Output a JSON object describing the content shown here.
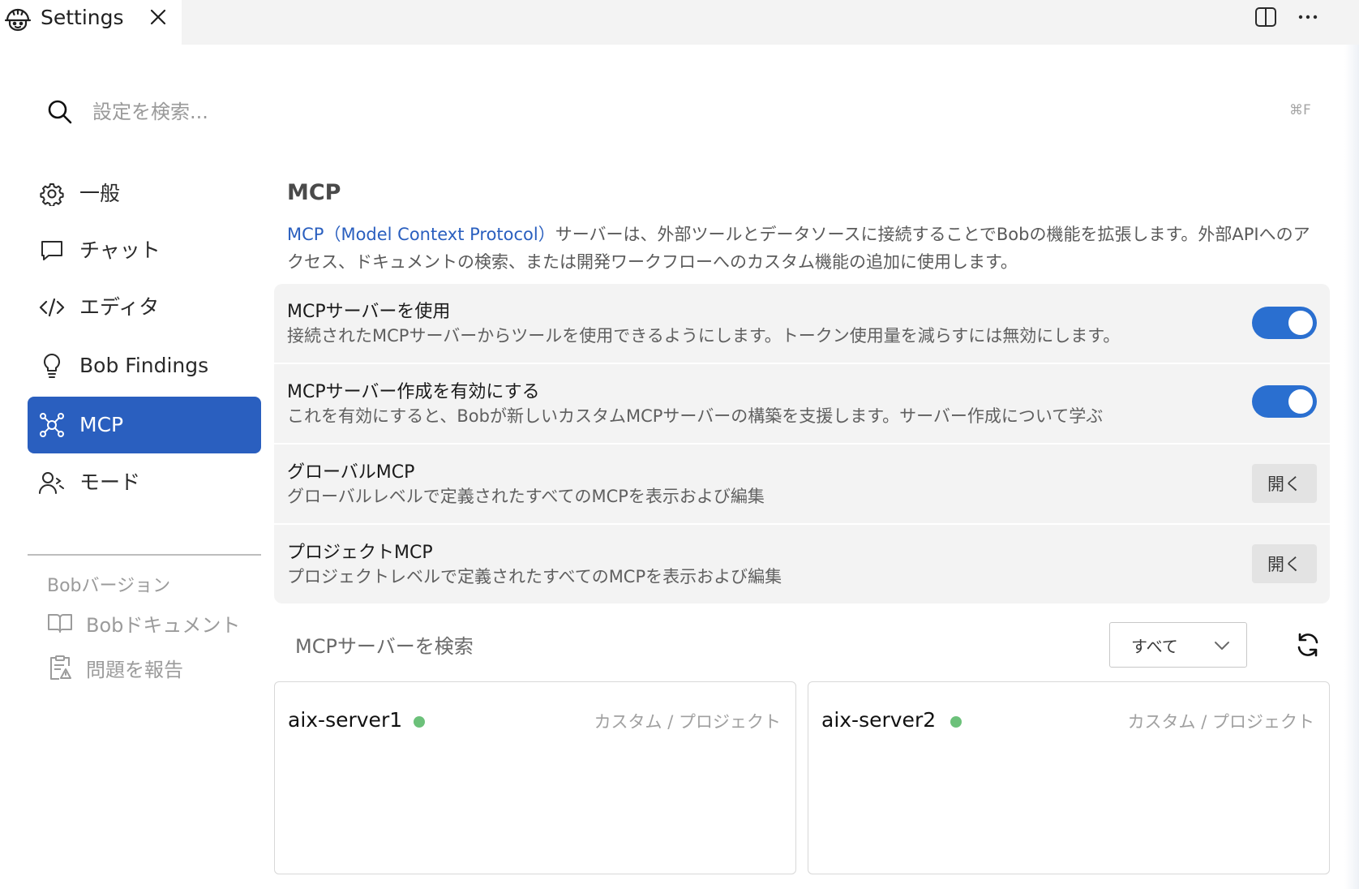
{
  "tab": {
    "title": "Settings",
    "logo_icon": "bob-helmet-icon",
    "close_icon": "close-icon"
  },
  "toolbar": {
    "split_icon": "split-editor-icon",
    "more_icon": "more-icon"
  },
  "search": {
    "placeholder": "設定を検索...",
    "value": "",
    "shortcut": "⌘F"
  },
  "sidebar": {
    "items": [
      {
        "label": "一般",
        "icon": "gear-icon",
        "active": false
      },
      {
        "label": "チャット",
        "icon": "chat-icon",
        "active": false
      },
      {
        "label": "エディタ",
        "icon": "code-icon",
        "active": false
      },
      {
        "label": "Bob Findings",
        "icon": "lightbulb-icon",
        "active": false
      },
      {
        "label": "MCP",
        "icon": "mcp-network-icon",
        "active": true
      },
      {
        "label": "モード",
        "icon": "users-icon",
        "active": false
      }
    ],
    "version_label": "Bobバージョン",
    "links": [
      {
        "label": "Bobドキュメント",
        "icon": "book-icon"
      },
      {
        "label": "問題を報告",
        "icon": "report-issue-icon"
      }
    ]
  },
  "main": {
    "title": "MCP",
    "description_link": "MCP（Model Context Protocol）",
    "description_text": "サーバーは、外部ツールとデータソースに接続することでBobの機能を拡張します。外部APIへのアクセス、ドキュメントの検索、または開発ワークフローへのカスタム機能の追加に使用します。",
    "settings": [
      {
        "title": "MCPサーバーを使用",
        "description": "接続されたMCPサーバーからツールを使用できるようにします。トークン使用量を減らすには無効にします。",
        "control": "toggle",
        "enabled": true
      },
      {
        "title": "MCPサーバー作成を有効にする",
        "description": "これを有効にすると、Bobが新しいカスタムMCPサーバーの構築を支援します。サーバー作成について学ぶ",
        "control": "toggle",
        "enabled": true
      },
      {
        "title": "グローバルMCP",
        "description": "グローバルレベルで定義されたすべてのMCPを表示および編集",
        "control": "button",
        "button_label": "開く"
      },
      {
        "title": "プロジェクトMCP",
        "description": "プロジェクトレベルで定義されたすべてのMCPを表示および編集",
        "control": "button",
        "button_label": "開く"
      }
    ],
    "server_search": {
      "placeholder": "MCPサーバーを検索",
      "value": ""
    },
    "filter": {
      "selected": "すべて",
      "chevron_icon": "chevron-down-icon"
    },
    "refresh_icon": "refresh-icon",
    "servers": [
      {
        "name": "aix-server1",
        "status": "connected",
        "status_color": "#6cc17a",
        "meta": "カスタム / プロジェクト"
      },
      {
        "name": "aix-server2",
        "status": "connected",
        "status_color": "#6cc17a",
        "meta": "カスタム / プロジェクト"
      }
    ]
  },
  "colors": {
    "accent": "#2a5fbf",
    "toggle_on": "#2a6fd0",
    "status_ok": "#6cc17a",
    "card_bg": "#f3f3f3"
  }
}
